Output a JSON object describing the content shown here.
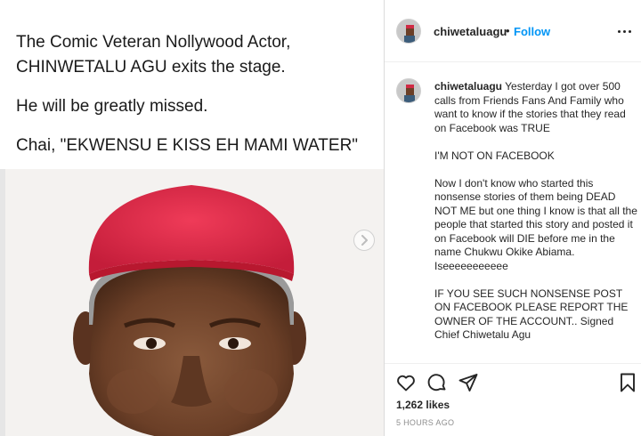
{
  "post": {
    "caption_lines": [
      "The Comic Veteran Nollywood Actor,",
      "CHINWETALU AGU exits the stage.",
      "He will be greatly missed.",
      "Chai, \"EKWENSU E KISS EH MAMI WATER\""
    ]
  },
  "header": {
    "username": "chiwetaluagu",
    "separator": "•",
    "follow_label": "Follow"
  },
  "comment": {
    "username": "chiwetaluagu",
    "paragraphs": [
      "Yesterday I got over 500 calls from Friends Fans And Family who want to know if the stories that they read on Facebook was TRUE",
      "I'M NOT ON FACEBOOK",
      "Now I don't know who started this nonsense stories of them being DEAD NOT ME but one thing I know is that all the people that started this story and posted it on Facebook will DIE before me in the name Chukwu Okike Abiama. Iseeeeeeeeeee",
      "IF YOU SEE SUCH NONSENSE POST ON FACEBOOK PLEASE REPORT THE OWNER OF THE ACCOUNT.. Signed Chief Chiwetalu Agu"
    ]
  },
  "footer": {
    "likes": "1,262 likes",
    "time": "5 HOURS AGO"
  },
  "colors": {
    "link_blue": "#0095f6",
    "text": "#262626",
    "muted": "#8e8e8e",
    "cap_red": "#e02a48"
  },
  "icons": [
    "chevron-right-icon",
    "more-options-icon",
    "heart-icon",
    "comment-icon",
    "share-icon",
    "bookmark-icon"
  ]
}
